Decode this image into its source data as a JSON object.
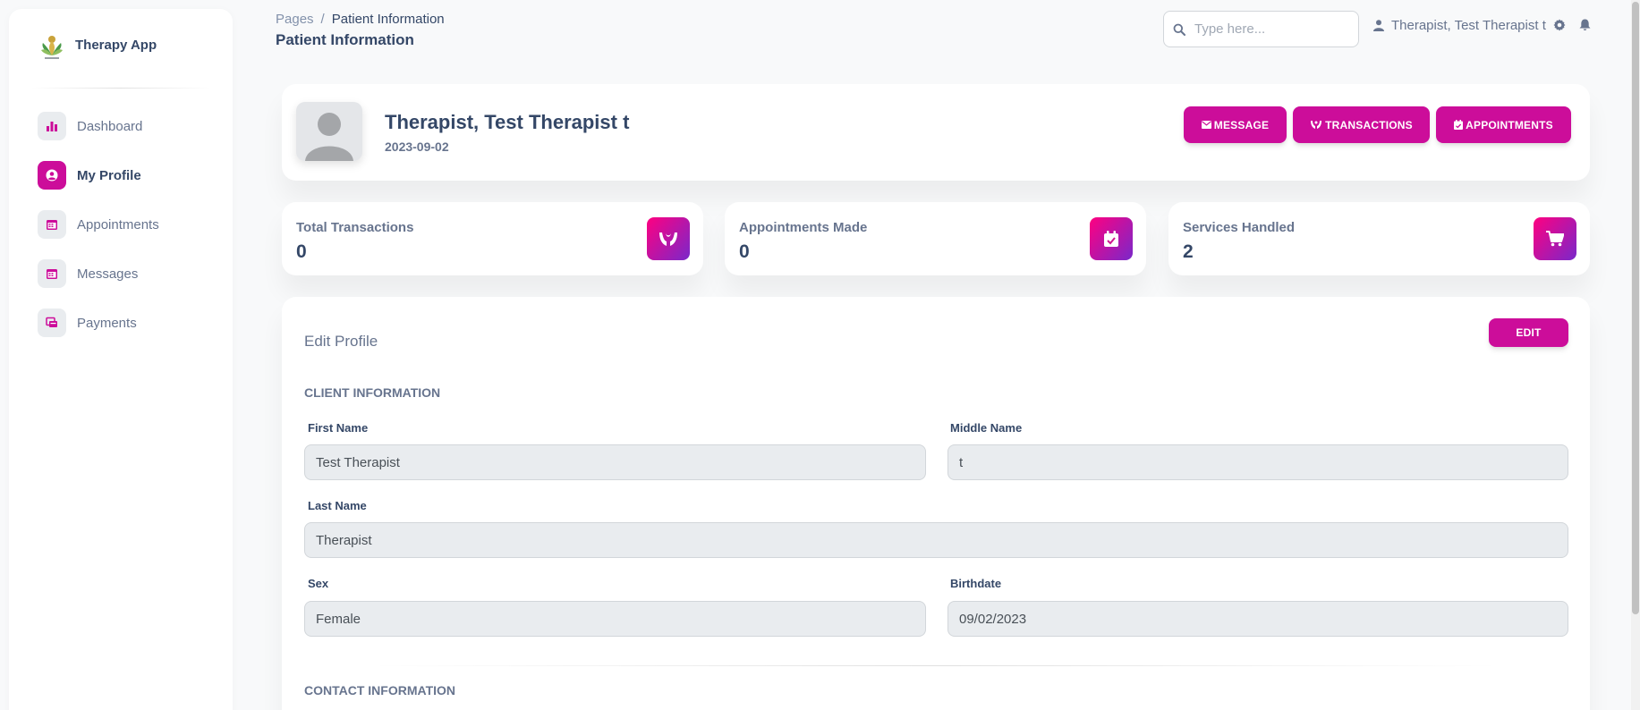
{
  "brand": {
    "name": "Therapy App",
    "logo_icon": "lotus-logo"
  },
  "sidebar": {
    "items": [
      {
        "label": "Dashboard",
        "icon": "chart-bar-icon",
        "active": false
      },
      {
        "label": "My Profile",
        "icon": "user-circle-icon",
        "active": true
      },
      {
        "label": "Appointments",
        "icon": "calendar-icon",
        "active": false
      },
      {
        "label": "Messages",
        "icon": "calendar-icon",
        "active": false
      },
      {
        "label": "Payments",
        "icon": "payment-icon",
        "active": false
      }
    ]
  },
  "header": {
    "breadcrumb_root": "Pages",
    "breadcrumb_sep": "/",
    "breadcrumb_current": "Patient Information",
    "title": "Patient Information",
    "search_placeholder": "Type here...",
    "user_name": "Therapist, Test Therapist t"
  },
  "profile": {
    "name": "Therapist, Test Therapist t",
    "date": "2023-09-02",
    "buttons": {
      "message": "MESSAGE",
      "transactions": "TRANSACTIONS",
      "appointments": "APPOINTMENTS"
    }
  },
  "stats": [
    {
      "label": "Total Transactions",
      "value": "0",
      "icon": "hands-icon"
    },
    {
      "label": "Appointments Made",
      "value": "0",
      "icon": "calendar-check-icon"
    },
    {
      "label": "Services Handled",
      "value": "2",
      "icon": "cart-icon"
    }
  ],
  "edit_profile": {
    "title": "Edit Profile",
    "edit_button": "EDIT",
    "client_section": "CLIENT INFORMATION",
    "contact_section": "CONTACT INFORMATION",
    "fields": {
      "first_name": {
        "label": "First Name",
        "value": "Test Therapist"
      },
      "middle_name": {
        "label": "Middle Name",
        "value": "t"
      },
      "last_name": {
        "label": "Last Name",
        "value": "Therapist"
      },
      "sex": {
        "label": "Sex",
        "value": "Female"
      },
      "birthdate": {
        "label": "Birthdate",
        "value": "09/02/2023"
      }
    }
  },
  "colors": {
    "accent": "#cc0d9a",
    "gradient_start": "#7928ca",
    "gradient_end": "#ff0080",
    "text": "#344767",
    "muted": "#67748e"
  }
}
